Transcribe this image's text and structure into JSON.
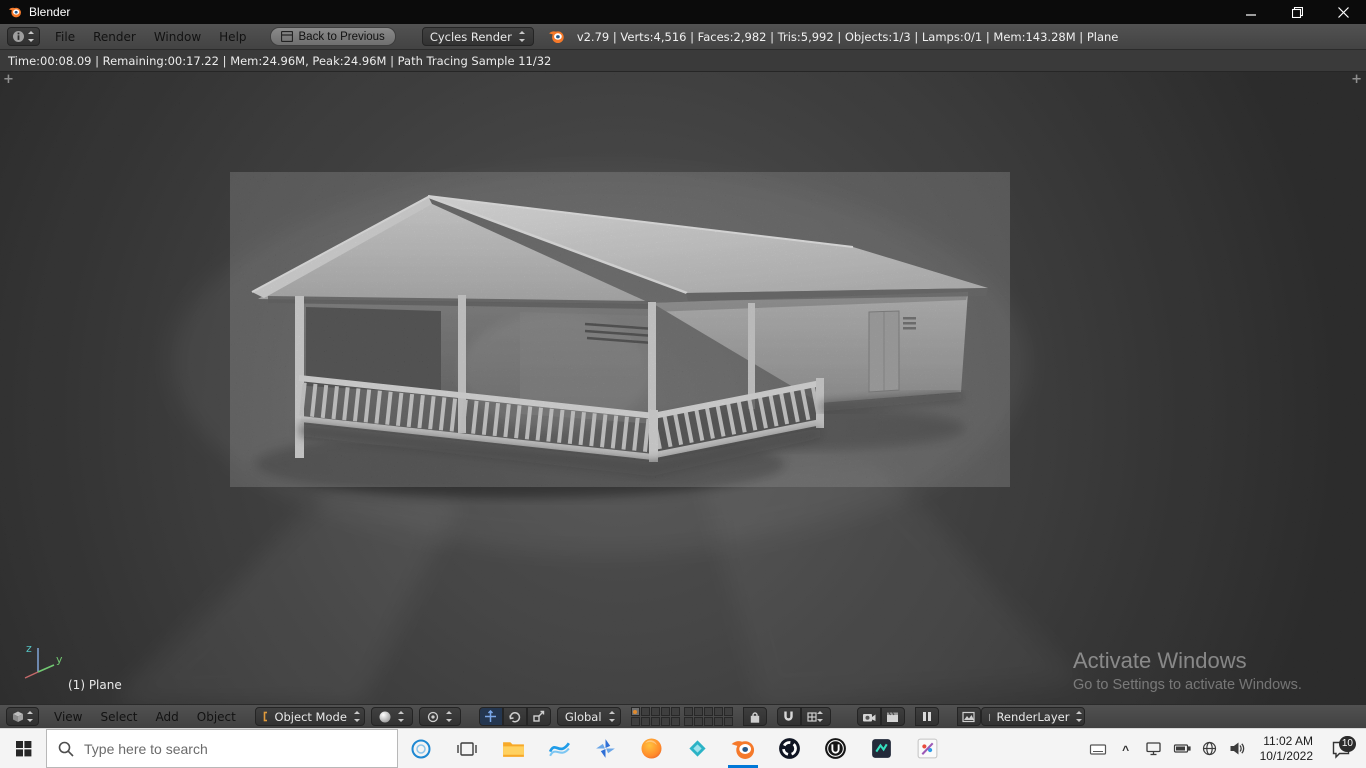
{
  "window": {
    "title": "Blender"
  },
  "top_header": {
    "menus": [
      "File",
      "Render",
      "Window",
      "Help"
    ],
    "back_button": "Back to Previous",
    "engine": "Cycles Render",
    "stats": "v2.79 | Verts:4,516 | Faces:2,982 | Tris:5,992 | Objects:1/3 | Lamps:0/1 | Mem:143.28M | Plane"
  },
  "render_status": {
    "text": "Time:00:08.09 | Remaining:00:17.22 | Mem:24.96M, Peak:24.96M | Path Tracing Sample 11/32"
  },
  "viewport": {
    "object_info": "(1) Plane",
    "axis": {
      "z": "z",
      "y": "y"
    },
    "watermark": {
      "title": "Activate Windows",
      "subtitle": "Go to Settings to activate Windows."
    }
  },
  "view3d_header": {
    "menus": [
      "View",
      "Select",
      "Add",
      "Object"
    ],
    "mode": "Object Mode",
    "orientation": "Global",
    "render_layer": "RenderLayer"
  },
  "taskbar": {
    "search_placeholder": "Type here to search",
    "time": "11:02 AM",
    "date": "10/1/2022",
    "badge": "10"
  },
  "icons": {
    "area_split": "+",
    "tray_expand": "^"
  },
  "colors": {
    "accent_blue": "#0078d7",
    "blender_orange": "#f5792a",
    "header_gray": "#474747",
    "viewport_dark": "#1d1d1d",
    "taskbar_light": "#f4f4f4"
  }
}
